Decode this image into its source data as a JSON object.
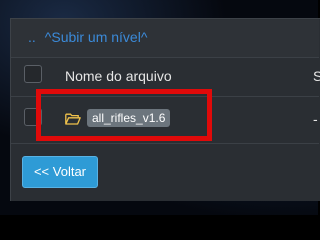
{
  "up_link": {
    "dots": "..",
    "label": "^Subir um nível^"
  },
  "table": {
    "columns": [
      "Nome do arquivo",
      "S"
    ],
    "rows": [
      {
        "icon": "folder-open-icon",
        "name": "all_rifles_v1.6",
        "size": "-"
      }
    ]
  },
  "actions": {
    "back_label": "<< Voltar"
  },
  "colors": {
    "panel_bg": "#2a2e33",
    "link": "#3b8ad9",
    "badge_bg": "#6c757d",
    "highlight": "#e00a0a",
    "button_bg": "#2e9bd6",
    "folder_icon": "#f0c24b"
  }
}
